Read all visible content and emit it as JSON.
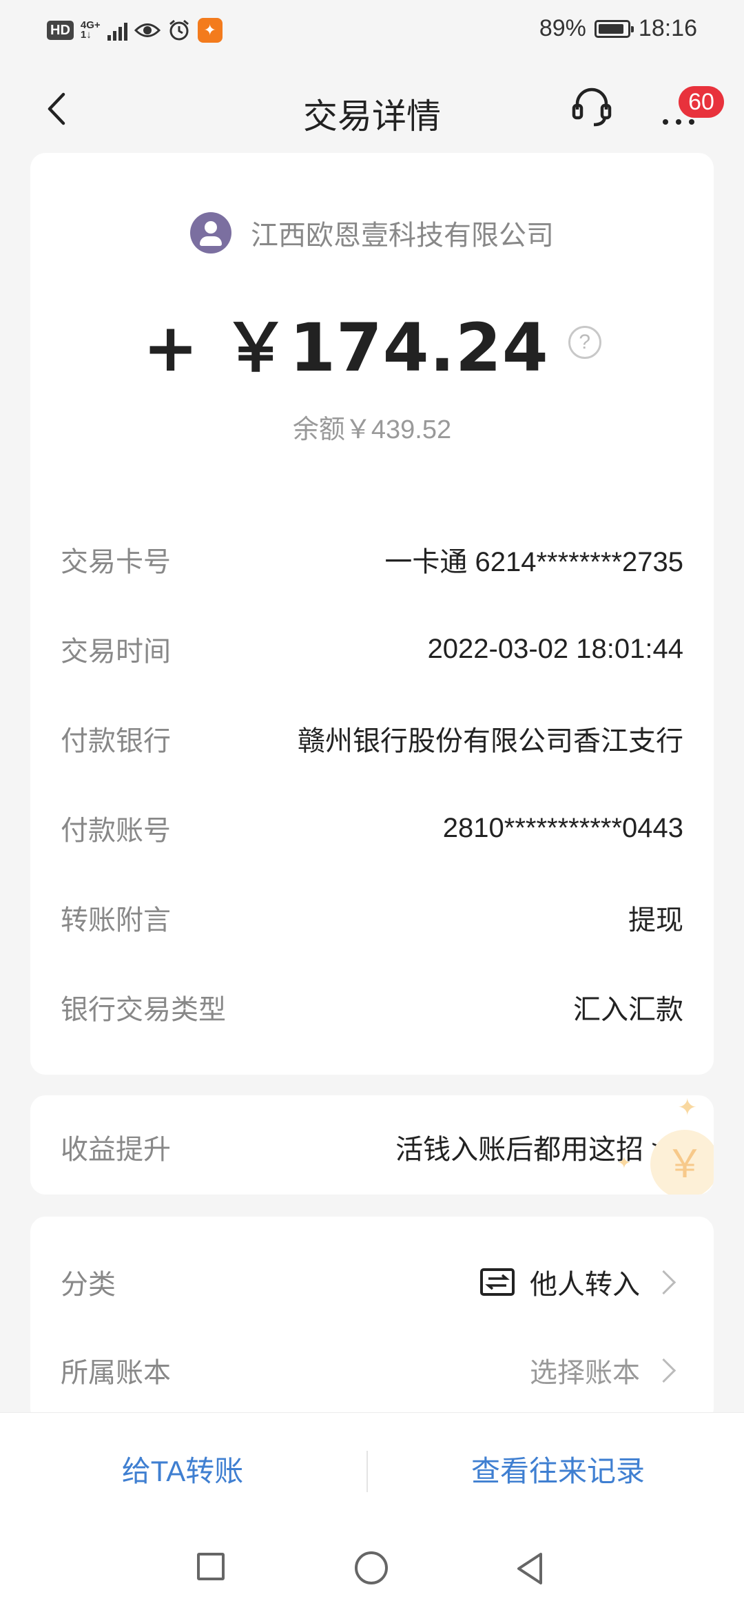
{
  "status_bar": {
    "hd": "HD",
    "network": "4G+",
    "network_sub": "1↓",
    "uc_icon": "uc-browser-icon",
    "battery": "89%",
    "battery_level": 0.89,
    "time": "18:16"
  },
  "header": {
    "title": "交易详情",
    "badge_count": "60",
    "icons": [
      "back-arrow-icon",
      "customer-service-icon",
      "more-icon"
    ]
  },
  "transaction": {
    "payer": "江西欧恩壹科技有限公司",
    "amount": "+ ￥174.24",
    "help_glyph": "?",
    "balance": "余额￥439.52",
    "details": [
      {
        "label": "交易卡号",
        "value": "一卡通 6214********2735"
      },
      {
        "label": "交易时间",
        "value": "2022-03-02 18:01:44"
      },
      {
        "label": "付款银行",
        "value": "赣州银行股份有限公司香江支行"
      },
      {
        "label": "付款账号",
        "value": "2810***********0443"
      },
      {
        "label": "转账附言",
        "value": "提现"
      },
      {
        "label": "银行交易类型",
        "value": "汇入汇款"
      }
    ]
  },
  "promo": {
    "label": "收益提升",
    "text": "活钱入账后都用这招 >>",
    "deco_glyph": "￥"
  },
  "category": {
    "label": "分类",
    "value": "他人转入",
    "book_label": "所属账本",
    "book_value": "选择账本"
  },
  "actions": {
    "transfer": "给TA转账",
    "history": "查看往来记录"
  },
  "colors": {
    "accent_blue": "#3f7fd1",
    "badge_red": "#e8323c",
    "avatar_purple": "#7b6fa0"
  }
}
